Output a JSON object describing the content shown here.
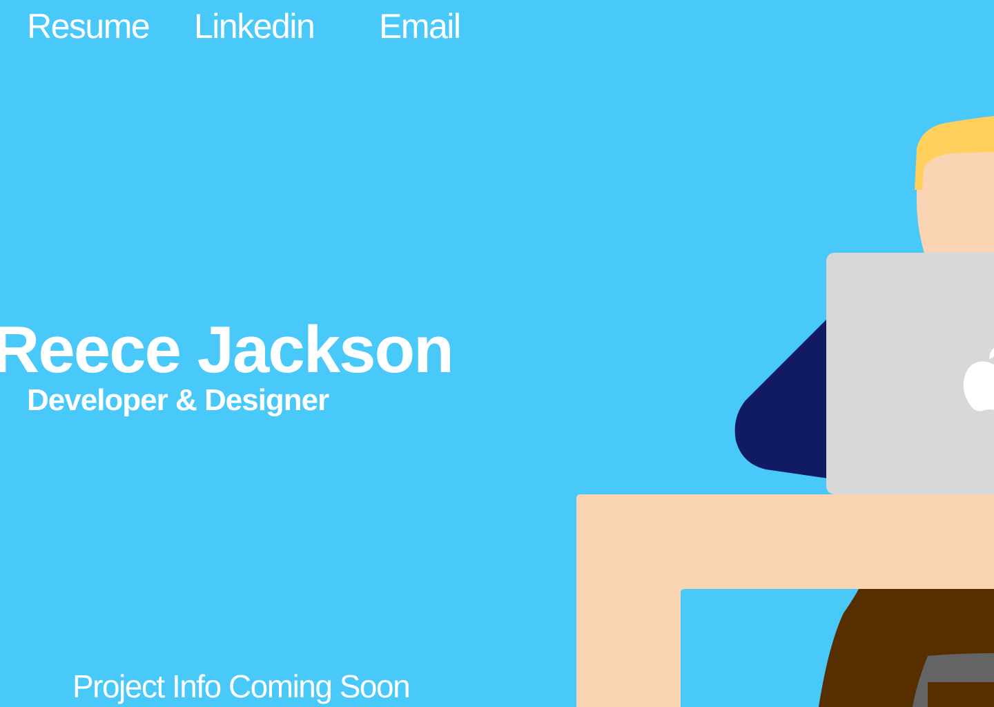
{
  "nav": {
    "resume_label": "Resume",
    "linkedin_label": "Linkedin",
    "email_label": "Email"
  },
  "hero": {
    "name": "Reece Jackson",
    "subtitle": "Developer & Designer"
  },
  "footer": {
    "project_info": "Project Info Coming Soon"
  },
  "colors": {
    "background": "#48C9FA",
    "text": "#FFFFFF",
    "skin": "#FBD5B3",
    "hair": "#FFD15C",
    "shirt": "#101B63",
    "laptop": "#D8D8D8",
    "desk": "#FBD5B3",
    "pants": "#562E00",
    "chair": "#646464"
  },
  "icons": {
    "laptop_logo": "apple-logo-icon"
  }
}
